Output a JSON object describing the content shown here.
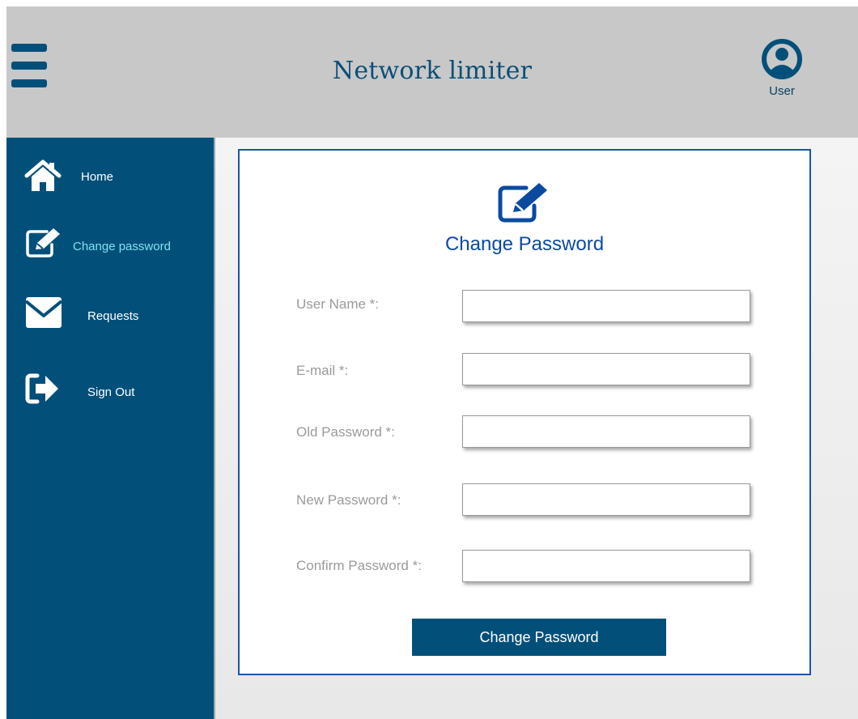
{
  "header": {
    "title": "Network limiter",
    "user_label": "User",
    "menu_icon": "hamburger-menu-icon",
    "user_icon": "user-avatar-icon"
  },
  "sidebar": {
    "items": [
      {
        "label": "Home",
        "icon": "home-icon",
        "active": false
      },
      {
        "label": "Change password",
        "icon": "edit-icon",
        "active": true
      },
      {
        "label": "Requests",
        "icon": "envelope-icon",
        "active": false
      },
      {
        "label": "Sign Out",
        "icon": "sign-out-icon",
        "active": false
      }
    ]
  },
  "form": {
    "title": "Change Password",
    "icon": "edit-icon",
    "fields": [
      {
        "label": "User Name *:",
        "value": "",
        "placeholder": ""
      },
      {
        "label": "E-mail *:",
        "value": "",
        "placeholder": ""
      },
      {
        "label": "Old Password *:",
        "value": "",
        "placeholder": ""
      },
      {
        "label": "New Password *:",
        "value": "",
        "placeholder": ""
      },
      {
        "label": "Confirm Password *:",
        "value": "",
        "placeholder": ""
      }
    ],
    "submit_label": "Change Password"
  },
  "colors": {
    "primary": "#02507a",
    "header_bg": "#c8c8c8",
    "title_blue": "#0b4aa0",
    "active_nav_text": "#7fe3ee",
    "card_border": "#1a56a8"
  }
}
